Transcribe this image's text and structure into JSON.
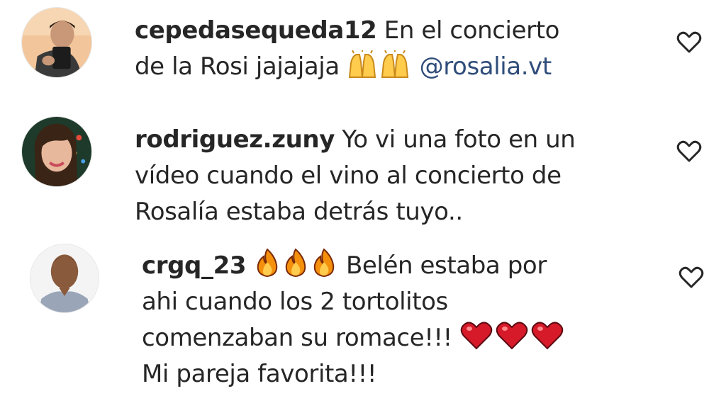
{
  "comments": [
    {
      "username": "cepedasequeda12",
      "lines": [
        {
          "before": " En el concierto",
          "emojis": [],
          "after": ""
        },
        {
          "before": "de la Rosi jajajaja ",
          "emojis": [
            "praising-hands-emoji",
            "praising-hands-emoji"
          ],
          "after": " ",
          "mention": "@rosalia.vt"
        }
      ]
    },
    {
      "username": "rodriguez.zuny",
      "lines": [
        {
          "before": " Yo vi una foto en un"
        },
        {
          "before": "vídeo cuando el vino al concierto de"
        },
        {
          "before": "Rosalía estaba detrás tuyo.."
        }
      ]
    },
    {
      "username": "crgq_23",
      "lines": [
        {
          "before": " ",
          "emojis": [
            "fire-emoji",
            "fire-emoji",
            "fire-emoji"
          ],
          "after": " Belén estaba por"
        },
        {
          "before": "ahi cuando los 2 tortolitos"
        },
        {
          "before": "comenzaban su romace!!! ",
          "emojis": [
            "red-heart-emoji",
            "red-heart-emoji",
            "red-heart-emoji"
          ],
          "after": ""
        },
        {
          "before": "Mi pareja favorita!!!"
        }
      ]
    }
  ],
  "icons": {
    "like": "heart-outline-icon"
  },
  "colors": {
    "text": "#262626",
    "mention": "#2f4d7a",
    "heart_emoji": "#d61a2a",
    "fire_outer": "#f4900c",
    "fire_inner": "#ffcc4d"
  }
}
